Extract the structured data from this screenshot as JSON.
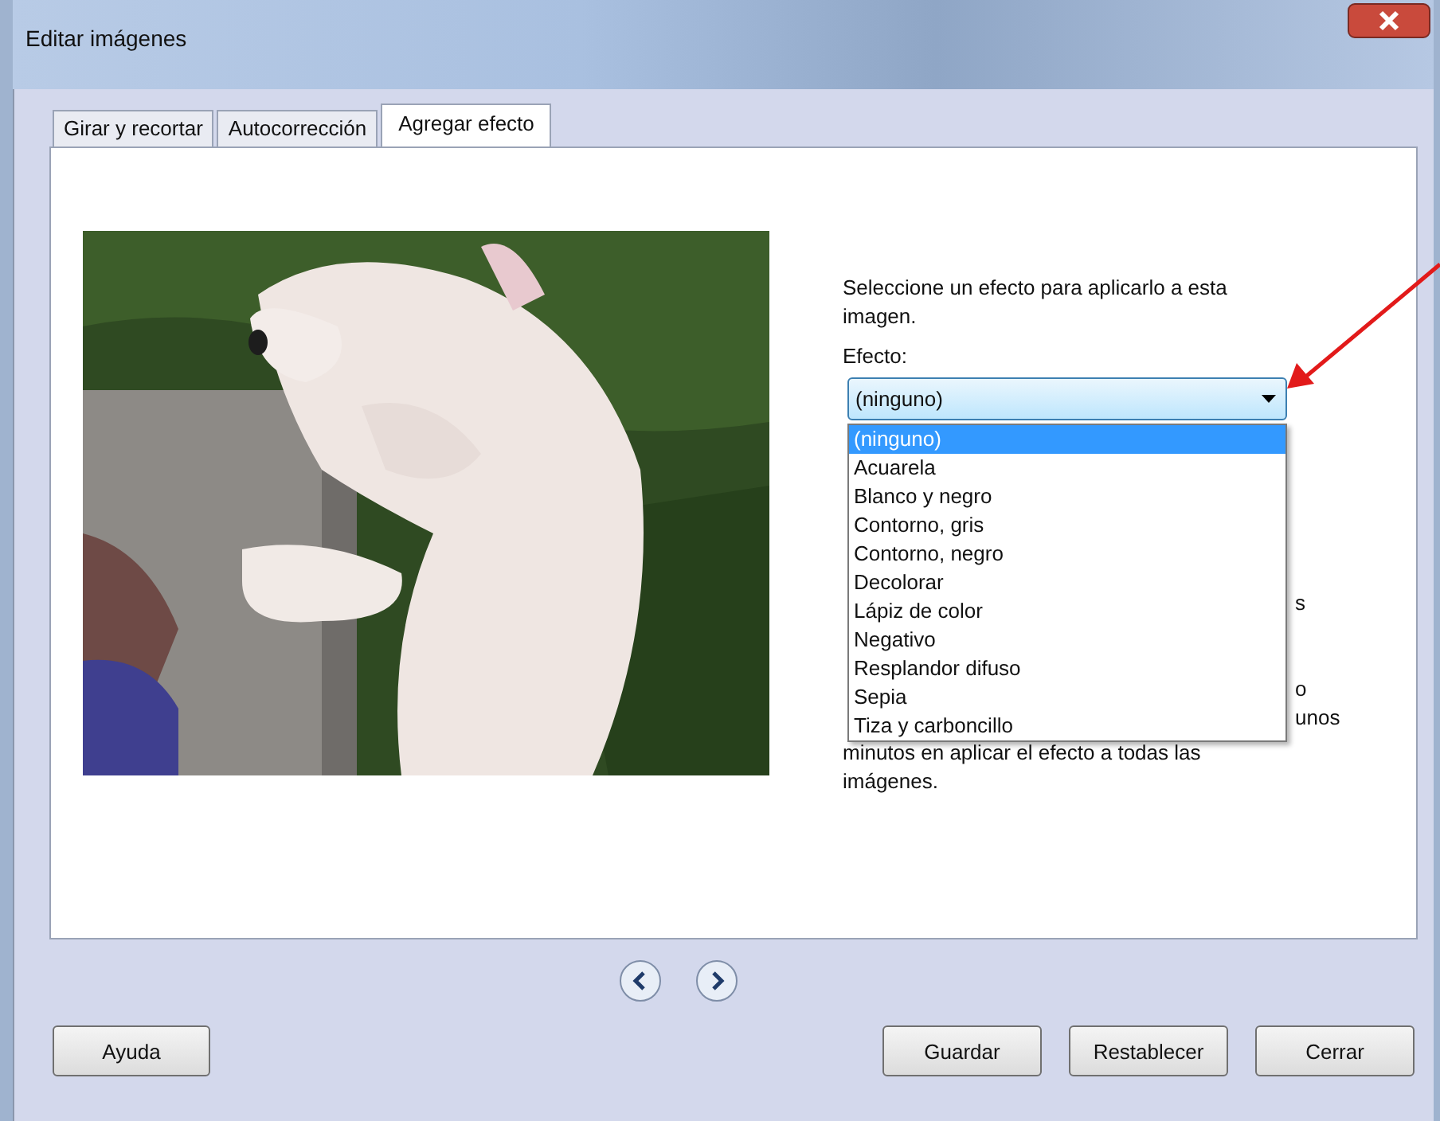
{
  "window": {
    "title": "Editar imágenes"
  },
  "tabs": [
    {
      "label": "Girar y recortar",
      "selected": false
    },
    {
      "label": "Autocorrección",
      "selected": false
    },
    {
      "label": "Agregar efecto",
      "selected": true
    }
  ],
  "instructions": "Seleccione un efecto para aplicarlo a esta imagen.",
  "effect": {
    "label": "Efecto:",
    "value": "(ninguno)",
    "expanded": true,
    "options": [
      {
        "label": "(ninguno)",
        "selected": true
      },
      {
        "label": "Acuarela",
        "selected": false
      },
      {
        "label": "Blanco y negro",
        "selected": false
      },
      {
        "label": "Contorno, gris",
        "selected": false
      },
      {
        "label": "Contorno, negro",
        "selected": false
      },
      {
        "label": "Decolorar",
        "selected": false
      },
      {
        "label": "Lápiz de color",
        "selected": false
      },
      {
        "label": "Negativo",
        "selected": false
      },
      {
        "label": "Resplandor difuso",
        "selected": false
      },
      {
        "label": "Sepia",
        "selected": false
      },
      {
        "label": "Tiza y carboncillo",
        "selected": false
      }
    ]
  },
  "note_fragments": [
    {
      "right": "s"
    },
    {
      "right": "o"
    },
    {
      "right": "unos"
    }
  ],
  "note_lines": [
    "minutos en aplicar el efecto a todas las",
    "imágenes."
  ],
  "buttons": [
    {
      "label": "Ayuda"
    },
    {
      "label": "Guardar"
    },
    {
      "label": "Restablecer"
    },
    {
      "label": "Cerrar"
    }
  ]
}
